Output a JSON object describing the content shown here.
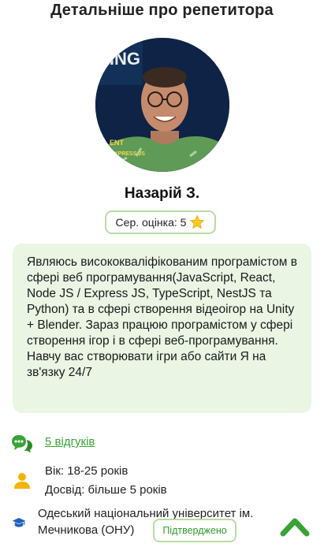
{
  "header": {
    "title": "Детальніше про репетитора"
  },
  "tutor": {
    "name": "Назарій З.",
    "rating_label": "Сер. оцінка: 5",
    "rating": 5,
    "bio": "Являюсь висококваліфікованим програмістом в сфері веб програмування(JavaScript, React, Node JS / Express JS, TypeScript, NestJS та Python) та в сфері створення відеоігор на Unity + Blender. Зараз працюю програмістом у сфері створення ігор і в сфері веб-програмування. Навчу вас створювати ігри або сайти Я на зв'язку 24/7",
    "avatar_text": {
      "top": "NING",
      "shirt": "ENT\nXPRESS JS"
    }
  },
  "details": {
    "reviews_link": "5 відгуків",
    "age": "Вік: 18-25 років",
    "experience": "Досвід: більше 5 років",
    "education": "Одеський національний університет ім. Мечникова (ОНУ)",
    "verified_label": "Підтверджено"
  },
  "colors": {
    "accent_green": "#39a335",
    "badge_border": "#b9dca4",
    "card_bg": "#eaf5e3",
    "person_icon": "#f4b400",
    "education_icon": "#1f5fbf"
  }
}
